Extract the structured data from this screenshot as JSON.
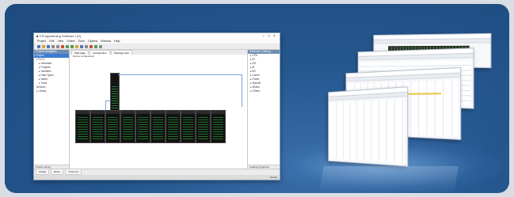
{
  "app": {
    "title": "■ 3 Programming Software ▪ [0]",
    "window_buttons": [
      "–",
      "□",
      "×"
    ]
  },
  "menu": [
    "Project",
    "Edit",
    "View",
    "Online",
    "Tools",
    "Options",
    "Window",
    "Help"
  ],
  "left_pane": {
    "header": "Project Navigation",
    "tree": [
      "▾ Project",
      "▾ PLC1",
      "▸ Hardware",
      "▸ Program",
      "▸ Variables",
      "▸ Data Types",
      "▸ Watch",
      "▸ Trace",
      "Devices",
      "▸ Library"
    ],
    "footer_tabs": [
      "Project",
      "Library"
    ]
  },
  "center": {
    "tabs": [
      "Start page",
      "Configuration",
      "Topology view"
    ],
    "title": "Device configuration"
  },
  "right_pane": {
    "header": "Hardware Catalog",
    "tree": [
      "▸ CPU",
      "▸ DI",
      "▸ DO",
      "▸ AI",
      "▸ AO",
      "▸ Comm",
      "▸ Power",
      "▸ Special",
      "▸ Motion",
      "▸ Others"
    ],
    "footer_tabs": [
      "Catalog",
      "Properties"
    ]
  },
  "bottom_tabs": [
    "Output",
    "Errors",
    "Cross-ref"
  ],
  "status": "Ready",
  "modules": [
    1,
    2,
    3,
    4,
    5,
    6,
    7,
    8,
    9,
    10
  ],
  "colors": {
    "background": "#25578f",
    "accent": "#3c7bd1",
    "module_led": "#1f6e2a"
  }
}
